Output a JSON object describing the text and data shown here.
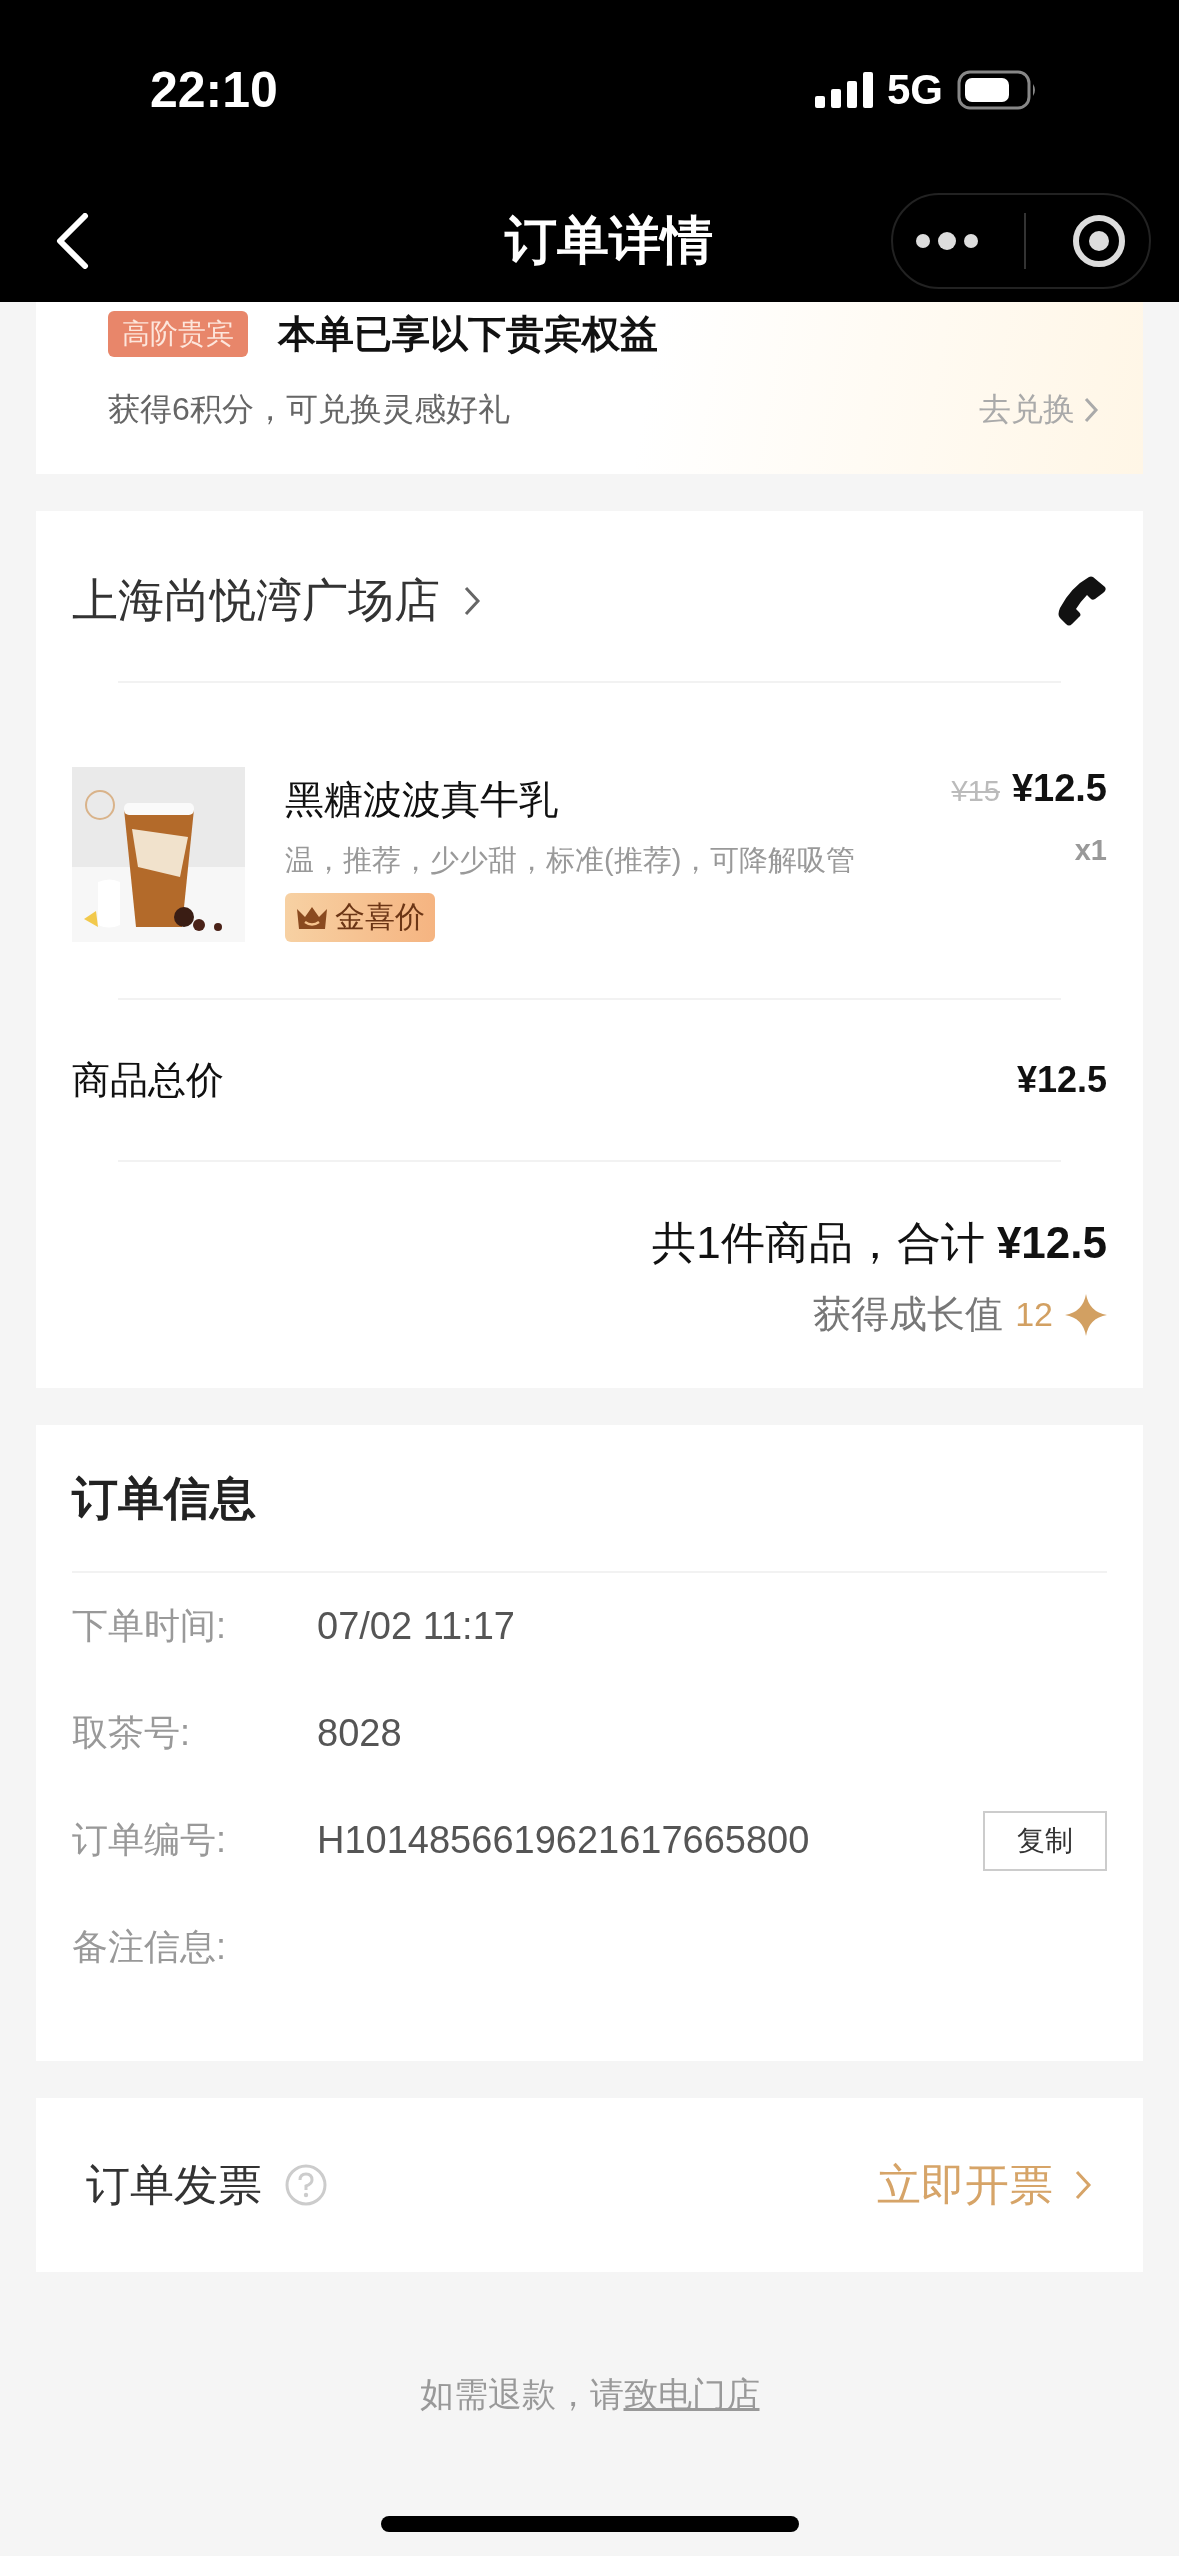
{
  "status_bar": {
    "time": "22:10",
    "network": "5G"
  },
  "nav": {
    "title": "订单详情"
  },
  "vip": {
    "badge": "高阶贵宾",
    "title": "本单已享以下贵宾权益",
    "points": "获得6积分，可兑换灵感好礼",
    "action": "去兑换"
  },
  "store": {
    "name": "上海尚悦湾广场店",
    "items": [
      {
        "name": "黑糖波波真牛乳",
        "options": "温，推荐，少少甜，标准(推荐)，可降解吸管",
        "original_price": "¥15",
        "price": "¥12.5",
        "quantity": "x1",
        "tag": "金喜价"
      }
    ],
    "subtotal_label": "商品总价",
    "subtotal": "¥12.5",
    "total": "共1件商品，合计 **¥12.5**",
    "growth_label": "获得成长值",
    "growth_value": "12"
  },
  "order_info": {
    "title": "订单信息",
    "rows": [
      {
        "label": "下单时间:",
        "value": "07/02 11:17"
      },
      {
        "label": "取茶号:",
        "value": "8028"
      },
      {
        "label": "订单编号:",
        "value": "H1014856619621617665800",
        "action": "复制"
      },
      {
        "label": "备注信息:"
      }
    ]
  },
  "invoice": {
    "label": "订单发票",
    "action": "立即开票"
  },
  "footer": {
    "text": "如需退款，请",
    "link": "致电门店"
  }
}
